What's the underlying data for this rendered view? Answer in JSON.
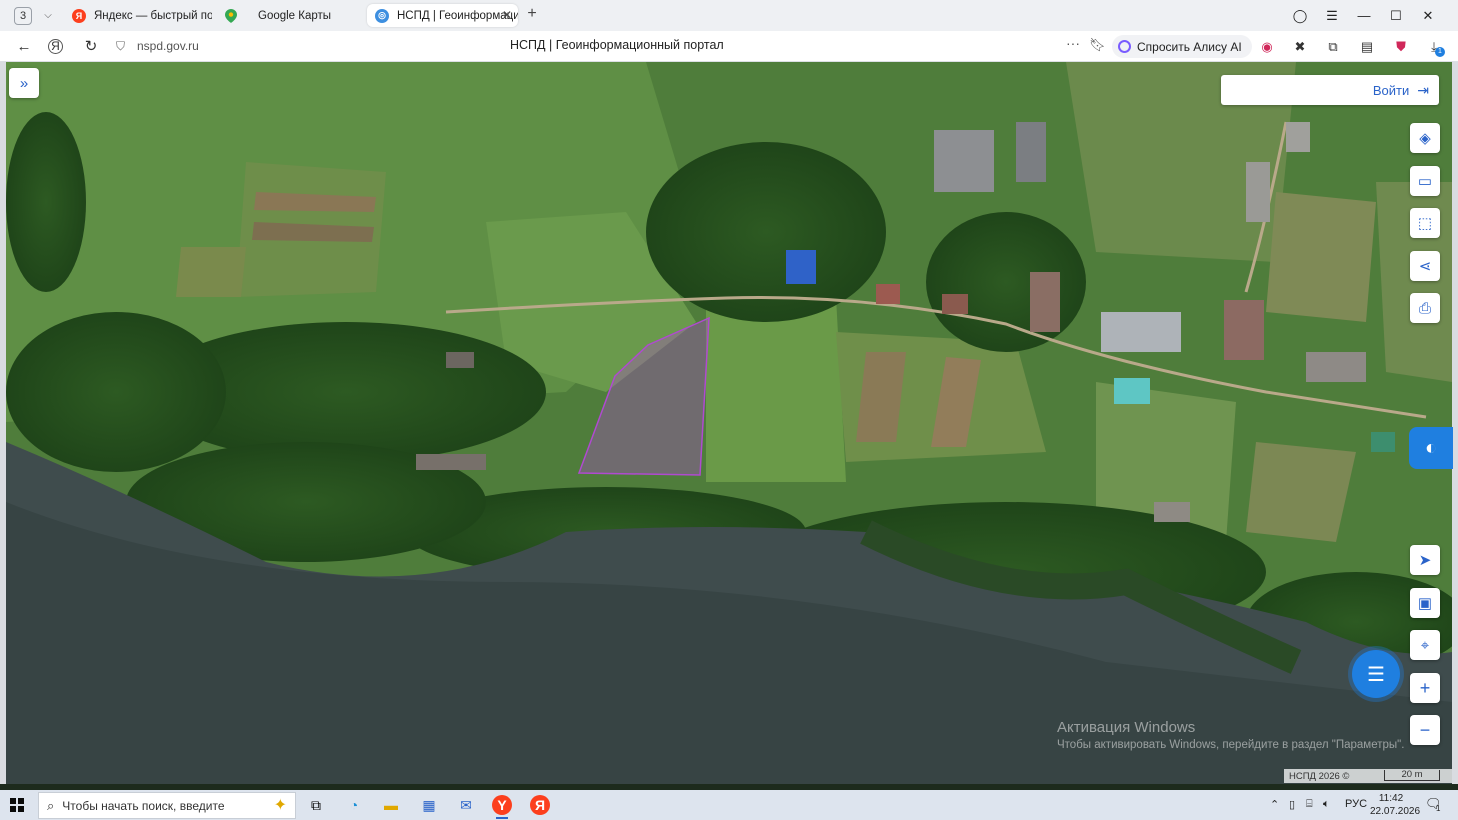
{
  "browser": {
    "tab_count": "3",
    "tabs": [
      {
        "label": "Яндекс — быстрый поиск",
        "favicon": "yandex-icon",
        "active": false
      },
      {
        "label": "Google Карты",
        "favicon": "google-maps-icon",
        "active": false
      },
      {
        "label": "НСПД | Геоинформаци",
        "favicon": "nspd-icon",
        "active": true
      }
    ],
    "url": "nspd.gov.ru",
    "page_title": "НСПД | Геоинформационный портал",
    "alice_label": "Спросить Алису AI",
    "download_badge": "1"
  },
  "map": {
    "login_label": "Войти",
    "tools": [
      "layers-icon",
      "ruler-icon",
      "select-area-icon",
      "share-icon",
      "print-icon"
    ],
    "nav_tools": [
      "locate-icon",
      "minimap-icon",
      "geo-search-icon"
    ],
    "zoom_in": "+",
    "zoom_out": "−",
    "attribution": "НСПД 2026 ©",
    "scale_label": "20 m",
    "parcel_color": "#b04ad0",
    "accent_color": "#2a63c9"
  },
  "watermark": {
    "line1": "Активация Windows",
    "line2": "Чтобы активировать Windows, перейдите в раздел \"Параметры\"."
  },
  "taskbar": {
    "search_placeholder": "Чтобы начать поиск, введите",
    "language": "РУС",
    "time": "11:42",
    "date": "22.07.2026",
    "notification_count": "1"
  }
}
